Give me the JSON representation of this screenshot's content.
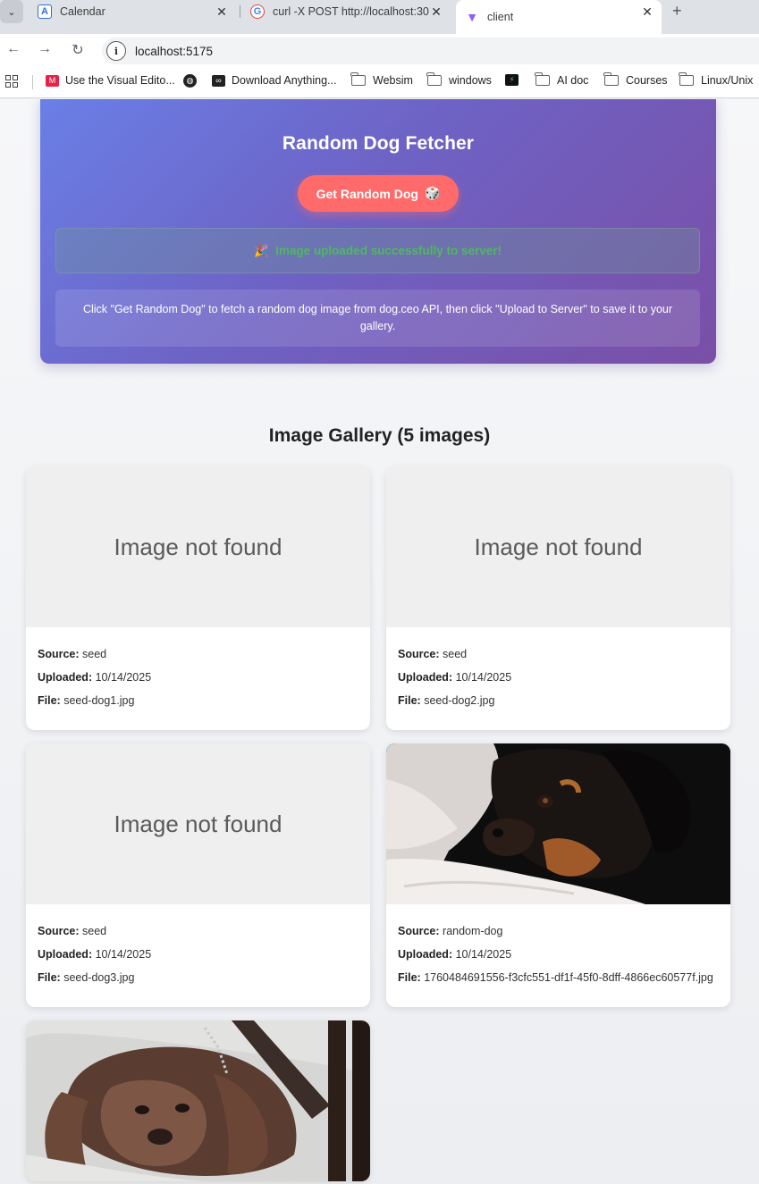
{
  "browser": {
    "tabs": [
      {
        "title": "Calendar",
        "active": false
      },
      {
        "title": "curl -X POST http://localhost:30",
        "active": false
      },
      {
        "title": "client",
        "active": true
      }
    ],
    "url": "localhost:5175",
    "bookmarks": [
      {
        "label": "Use the Visual Edito...",
        "icon": "miro-icon"
      },
      {
        "label": "",
        "icon": "globe-icon"
      },
      {
        "label": "Download Anything...",
        "icon": "infinity-icon"
      },
      {
        "label": "Websim",
        "icon": "folder-icon"
      },
      {
        "label": "windows",
        "icon": "folder-icon"
      },
      {
        "label": "",
        "icon": "app-icon"
      },
      {
        "label": "AI doc",
        "icon": "folder-icon"
      },
      {
        "label": "Courses",
        "icon": "folder-icon"
      },
      {
        "label": "Linux/Unix",
        "icon": "folder-icon"
      }
    ]
  },
  "hero": {
    "title": "Random Dog Fetcher",
    "button_label": "Get Random Dog",
    "button_emoji": "🎲",
    "success_emoji": "🎉",
    "success_message": "Image uploaded successfully to server!",
    "info_text": "Click \"Get Random Dog\" to fetch a random dog image from dog.ceo API, then click \"Upload to Server\" to save it to your gallery."
  },
  "gallery": {
    "title": "Image Gallery (5 images)",
    "labels": {
      "source": "Source:",
      "uploaded": "Uploaded:",
      "file": "File:"
    },
    "placeholder": "Image not found",
    "items": [
      {
        "source": "seed",
        "uploaded": "10/14/2025",
        "file": "seed-dog1.jpg",
        "image": "missing"
      },
      {
        "source": "seed",
        "uploaded": "10/14/2025",
        "file": "seed-dog2.jpg",
        "image": "missing"
      },
      {
        "source": "seed",
        "uploaded": "10/14/2025",
        "file": "seed-dog3.jpg",
        "image": "missing"
      },
      {
        "source": "random-dog",
        "uploaded": "10/14/2025",
        "file": "1760484691556-f3cfc551-df1f-45f0-8dff-4866ec60577f.jpg",
        "image": "dobermann-photo"
      },
      {
        "image": "spaniel-photo"
      }
    ]
  },
  "colors": {
    "hero_gradient_start": "#6a7fe6",
    "hero_gradient_end": "#7a4fa6",
    "button": "#ff6b6b",
    "success_text": "#4cba5e"
  }
}
